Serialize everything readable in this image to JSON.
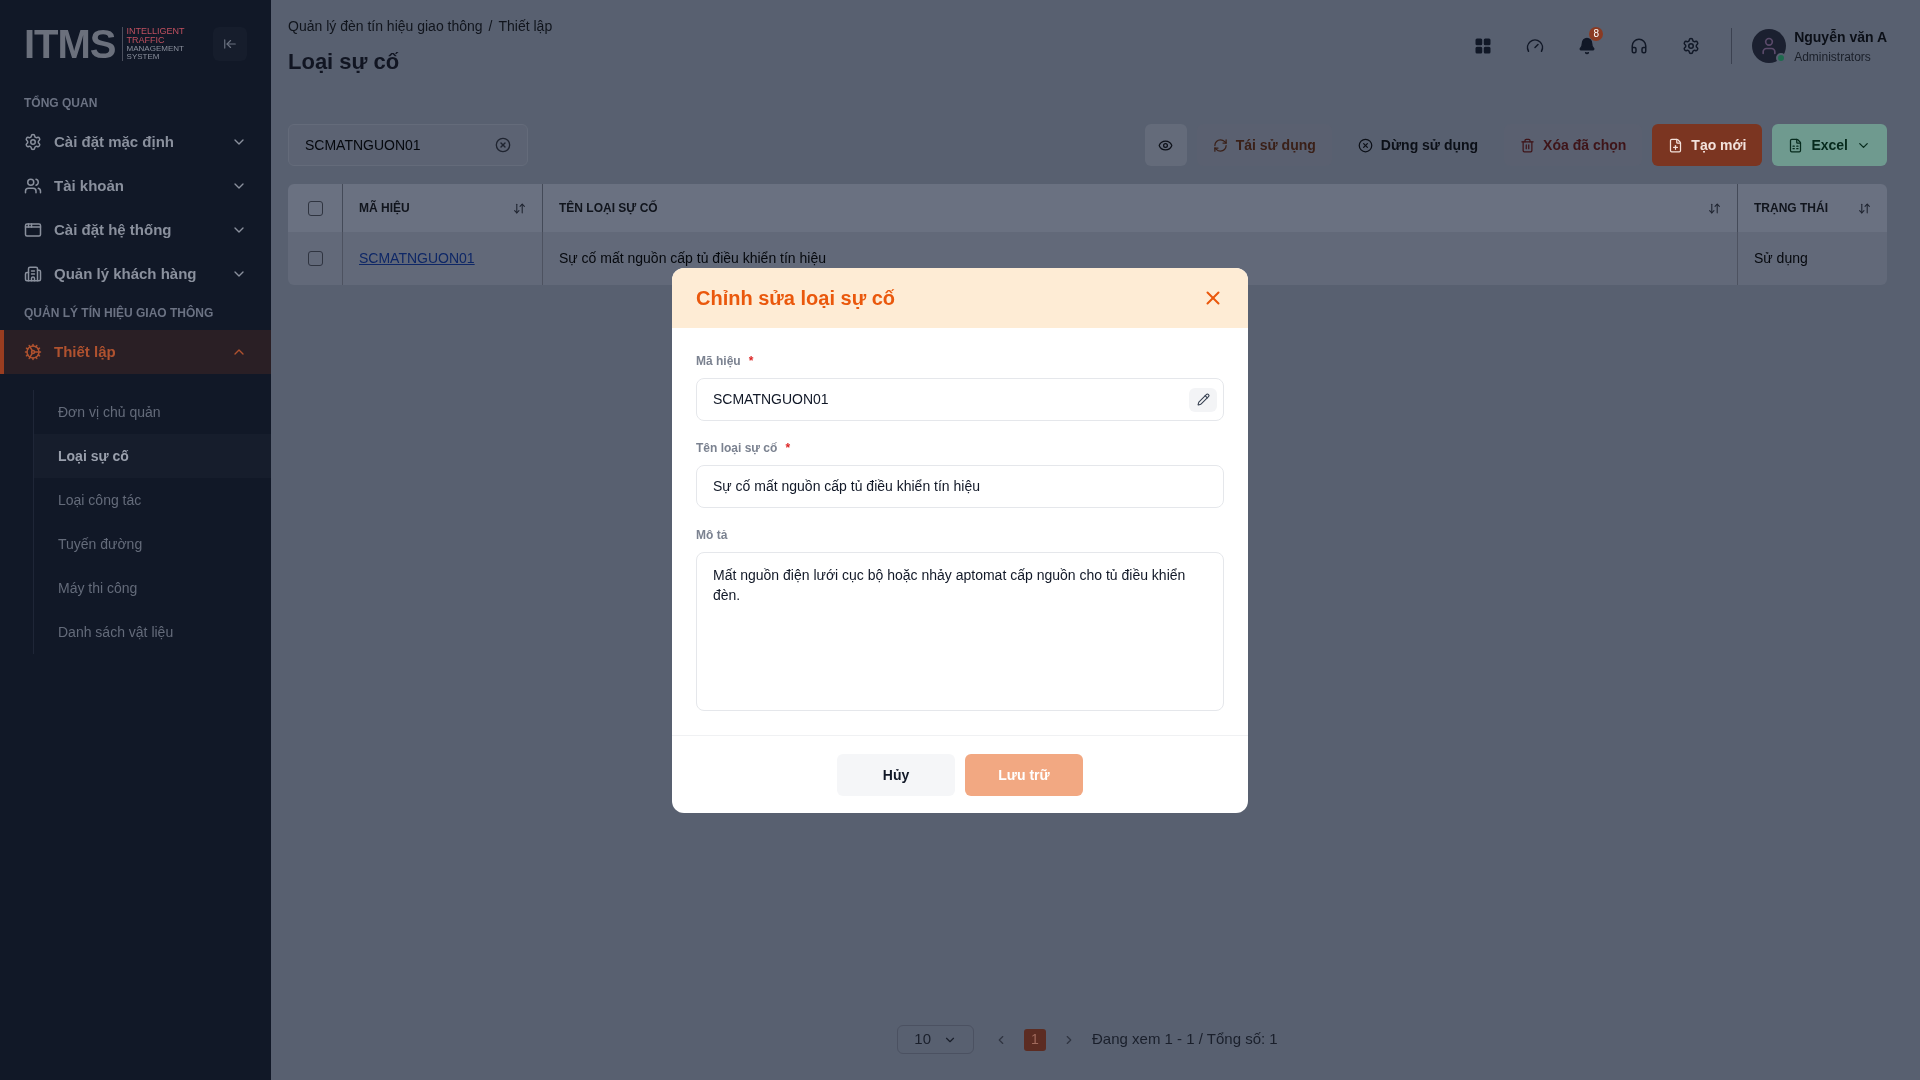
{
  "sidebar": {
    "logo": {
      "wordmark": "ITMS",
      "tagline": [
        "INTELLIGENT",
        "TRAFFIC",
        "MANAGEMENT",
        "SYSTEM"
      ]
    },
    "sections": [
      {
        "title": "TỔNG QUAN",
        "items": [
          {
            "label": "Cài đặt mặc định",
            "expanded": false,
            "selected": false
          },
          {
            "label": "Tài khoản",
            "expanded": false,
            "selected": false
          },
          {
            "label": "Cài đặt hệ thống",
            "expanded": false,
            "selected": false
          },
          {
            "label": "Quản lý khách hàng",
            "expanded": false,
            "selected": false
          }
        ]
      },
      {
        "title": "QUẢN LÝ TÍN HIỆU GIAO THÔNG",
        "items": [
          {
            "label": "Thiết lập",
            "expanded": true,
            "selected": true,
            "children": [
              {
                "label": "Đơn vị chủ quản",
                "selected": false
              },
              {
                "label": "Loại sự cố",
                "selected": true
              },
              {
                "label": "Loại công tác",
                "selected": false
              },
              {
                "label": "Tuyến đường",
                "selected": false
              },
              {
                "label": "Máy thi công",
                "selected": false
              },
              {
                "label": "Danh sách vật liệu",
                "selected": false
              }
            ]
          }
        ]
      }
    ]
  },
  "header": {
    "breadcrumb_separator": "/",
    "breadcrumbs": [
      "Quản lý đèn tín hiệu giao thông",
      "Thiết lập"
    ],
    "title": "Loại sự cố",
    "notification_count": "8",
    "user": {
      "name": "Nguyễn văn A",
      "role": "Administrators",
      "online": true
    }
  },
  "toolbar": {
    "search": {
      "value": "SCMATNGUON01"
    },
    "buttons": [
      {
        "kind": "view"
      },
      {
        "kind": "reuse",
        "label": "Tái sử dụng",
        "disabled": true
      },
      {
        "kind": "stop",
        "label": "Dừng sử dụng"
      },
      {
        "kind": "delete",
        "label": "Xóa đã chọn",
        "disabled": true
      },
      {
        "kind": "create",
        "label": "Tạo mới"
      },
      {
        "kind": "excel",
        "label": "Excel"
      }
    ]
  },
  "table": {
    "header_checked": false,
    "columns": [
      {
        "label": "MÃ HIỆU"
      },
      {
        "label": "TÊN LOẠI SỰ CỐ"
      },
      {
        "label": "TRẠNG THÁI"
      }
    ],
    "rows": [
      {
        "checked": false,
        "cells": [
          "SCMATNGUON01",
          "Sự cố mất nguồn cấp tủ điều khiển tín hiệu",
          "Sử dụng"
        ]
      }
    ]
  },
  "pagination": {
    "page_size": "10",
    "pages": [
      {
        "label": "1",
        "selected": true
      }
    ],
    "summary": "Đang xem 1 - 1 / Tổng số: 1"
  },
  "dialog": {
    "title": "Chỉnh sửa loại sự cố",
    "required_mark": "*",
    "fields": [
      {
        "kind": "input_with_edit",
        "label": "Mã hiệu",
        "required": true,
        "value": "SCMATNGUON01"
      },
      {
        "kind": "input",
        "label": "Tên loại sự cố",
        "required": true,
        "value": "Sự cố mất nguồn cấp tủ điều khiển tín hiệu"
      },
      {
        "kind": "textarea",
        "label": "Mô tả",
        "value": "Mất nguồn điện lưới cục bộ hoặc nhảy aptomat cấp nguồn cho tủ điều khiển đèn."
      }
    ],
    "buttons": [
      {
        "kind": "cancel",
        "label": "Hủy",
        "disabled": false
      },
      {
        "kind": "save",
        "label": "Lưu trữ",
        "disabled": true
      }
    ]
  }
}
